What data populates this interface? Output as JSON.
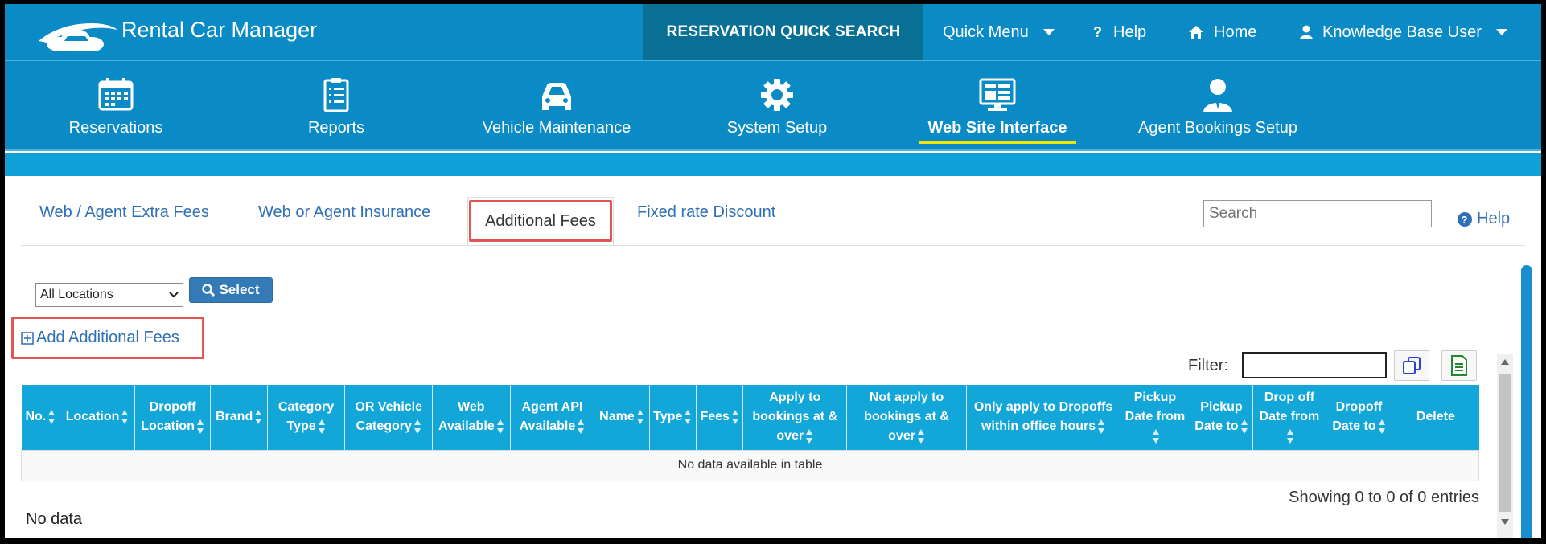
{
  "header": {
    "app_title": "Rental Car Manager",
    "quick_search": "RESERVATION QUICK SEARCH",
    "quick_menu": "Quick Menu",
    "help": "Help",
    "home": "Home",
    "user": "Knowledge Base User"
  },
  "nav": {
    "items": [
      {
        "label": "Reservations",
        "icon": "calendar-icon"
      },
      {
        "label": "Reports",
        "icon": "clipboard-icon"
      },
      {
        "label": "Vehicle Maintenance",
        "icon": "car-icon"
      },
      {
        "label": "System Setup",
        "icon": "gear-icon"
      },
      {
        "label": "Web Site Interface",
        "icon": "monitor-icon",
        "active": true
      },
      {
        "label": "Agent Bookings Setup",
        "icon": "agent-icon"
      }
    ]
  },
  "tabs": {
    "extra_fees": "Web / Agent Extra Fees",
    "insurance": "Web or Agent Insurance",
    "additional_fees": "Additional Fees",
    "fixed_rate": "Fixed rate Discount"
  },
  "search": {
    "placeholder": "Search"
  },
  "help_link": "Help",
  "location_select": {
    "selected": "All Locations"
  },
  "select_button": "Select",
  "add_link": "Add Additional Fees",
  "filter_label": "Filter:",
  "table": {
    "columns": [
      "No.",
      "Location",
      "Dropoff Location",
      "Brand",
      "Category Type",
      "OR Vehicle Category",
      "Web Available",
      "Agent API Available",
      "Name",
      "Type",
      "Fees",
      "Apply to bookings at & over",
      "Not apply to bookings at & over",
      "Only apply to Dropoffs within office hours",
      "Pickup Date from",
      "Pickup Date to",
      "Drop off Date from",
      "Dropoff Date to",
      "Delete"
    ],
    "empty_message": "No data available in table"
  },
  "showing": "Showing 0 to 0 of 0 entries",
  "no_data": "No data",
  "colors": {
    "header_blue": "#0b8bc6",
    "quick_search_bg": "#0a6f95",
    "table_header": "#13a7d9",
    "link_blue": "#2f6fb5",
    "highlight_red": "#e15554",
    "active_underline": "#f2e600"
  }
}
